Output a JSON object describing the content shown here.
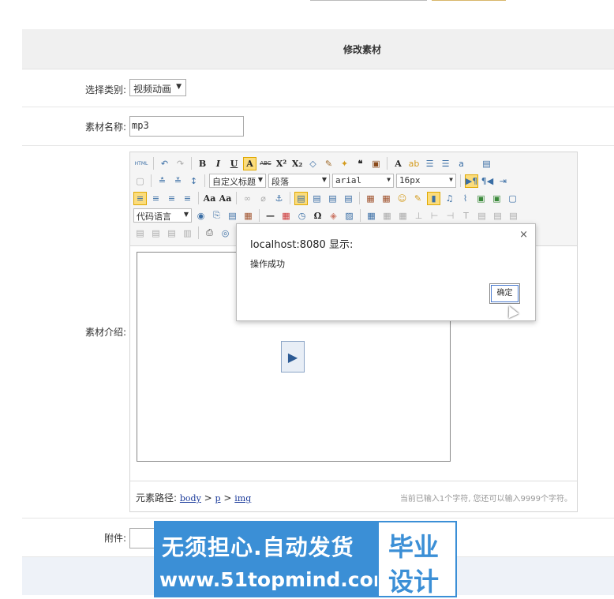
{
  "form": {
    "title": "修改素材",
    "category_label": "选择类别:",
    "category_value": "视频动画",
    "name_label": "素材名称:",
    "name_value": "mp3",
    "intro_label": "素材介绍:",
    "attachment_label": "附件:"
  },
  "editor": {
    "toolbar": {
      "html_label": "HTML",
      "heading_dropdown": "自定义标题",
      "paragraph_dropdown": "段落",
      "font_dropdown": "arial",
      "size_dropdown": "16px",
      "code_lang_dropdown": "代码语言"
    },
    "status": {
      "path_label": "元素路径:",
      "path_items": [
        "body",
        "p",
        "img"
      ],
      "path_sep": ">",
      "char_count": "当前已输入1个字符, 您还可以输入9999个字符。"
    }
  },
  "dialog": {
    "title": "localhost:8080 显示:",
    "message": "操作成功",
    "ok_label": "确定",
    "close_glyph": "×"
  },
  "watermark": {
    "line1": "无须担心.自动发货",
    "line2": "www.51topmind.com",
    "badge_line1": "毕业",
    "badge_line2": "设计"
  },
  "colors": {
    "header_bg": "#f0f0f0",
    "toolbar_active": "#fbdc7c",
    "link": "#1a3a9a",
    "watermark_blue": "#3b8fd6"
  }
}
